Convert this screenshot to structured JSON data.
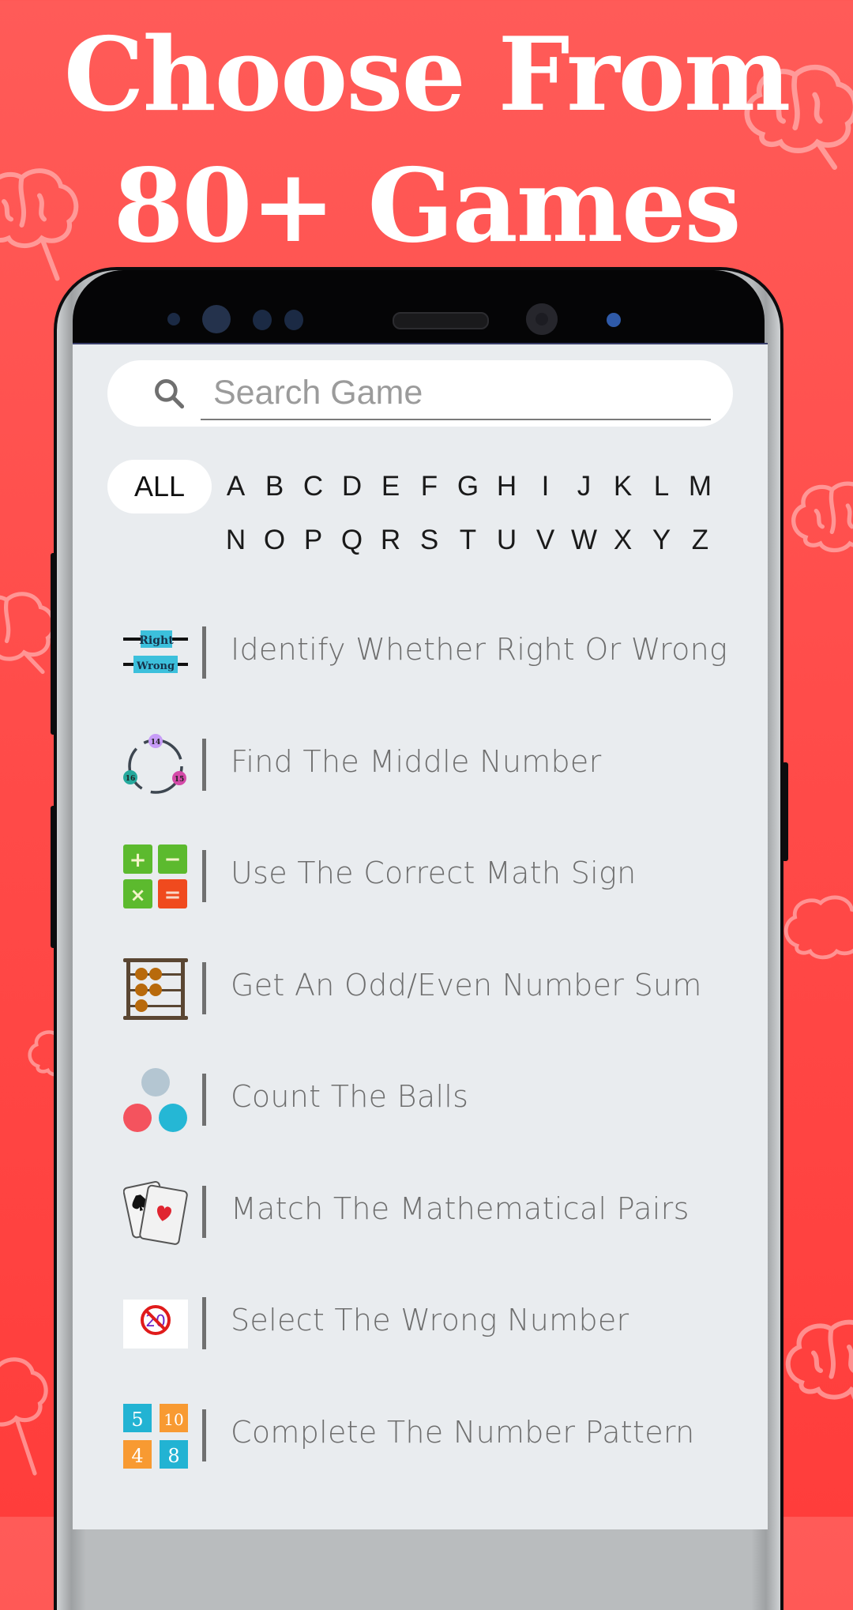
{
  "promo": {
    "headline_line1": "Choose From",
    "headline_line2": "80+ Games"
  },
  "colors": {
    "background": "#ff4b49",
    "screen_bg": "#e9ecef",
    "label_text": "#6e6e6e"
  },
  "search": {
    "icon": "search-icon",
    "placeholder": "Search Game",
    "value": ""
  },
  "filter": {
    "all_label": "ALL",
    "selected": "ALL",
    "letters": [
      "A",
      "B",
      "C",
      "D",
      "E",
      "F",
      "G",
      "H",
      "I",
      "J",
      "K",
      "L",
      "M",
      "N",
      "O",
      "P",
      "Q",
      "R",
      "S",
      "T",
      "U",
      "V",
      "W",
      "X",
      "Y",
      "Z"
    ]
  },
  "games": [
    {
      "label": "Identify Whether Right Or Wrong",
      "icon": "right-wrong-icon",
      "icon_text": [
        "Right",
        "Wrong"
      ]
    },
    {
      "label": "Find The Middle Number",
      "icon": "number-circle-icon",
      "icon_text": [
        "14",
        "15",
        "16"
      ]
    },
    {
      "label": "Use The Correct Math Sign",
      "icon": "math-signs-icon",
      "icon_text": [
        "+",
        "−",
        "×",
        "="
      ]
    },
    {
      "label": "Get An Odd/Even Number Sum",
      "icon": "abacus-icon"
    },
    {
      "label": "Count The Balls",
      "icon": "balls-icon"
    },
    {
      "label": "Match The Mathematical Pairs",
      "icon": "playing-cards-icon"
    },
    {
      "label": "Select The Wrong Number",
      "icon": "no-twenty-icon",
      "icon_text": [
        "20"
      ]
    },
    {
      "label": "Complete The Number Pattern",
      "icon": "number-pattern-icon",
      "icon_text": [
        "5",
        "10",
        "4",
        "8"
      ]
    }
  ]
}
